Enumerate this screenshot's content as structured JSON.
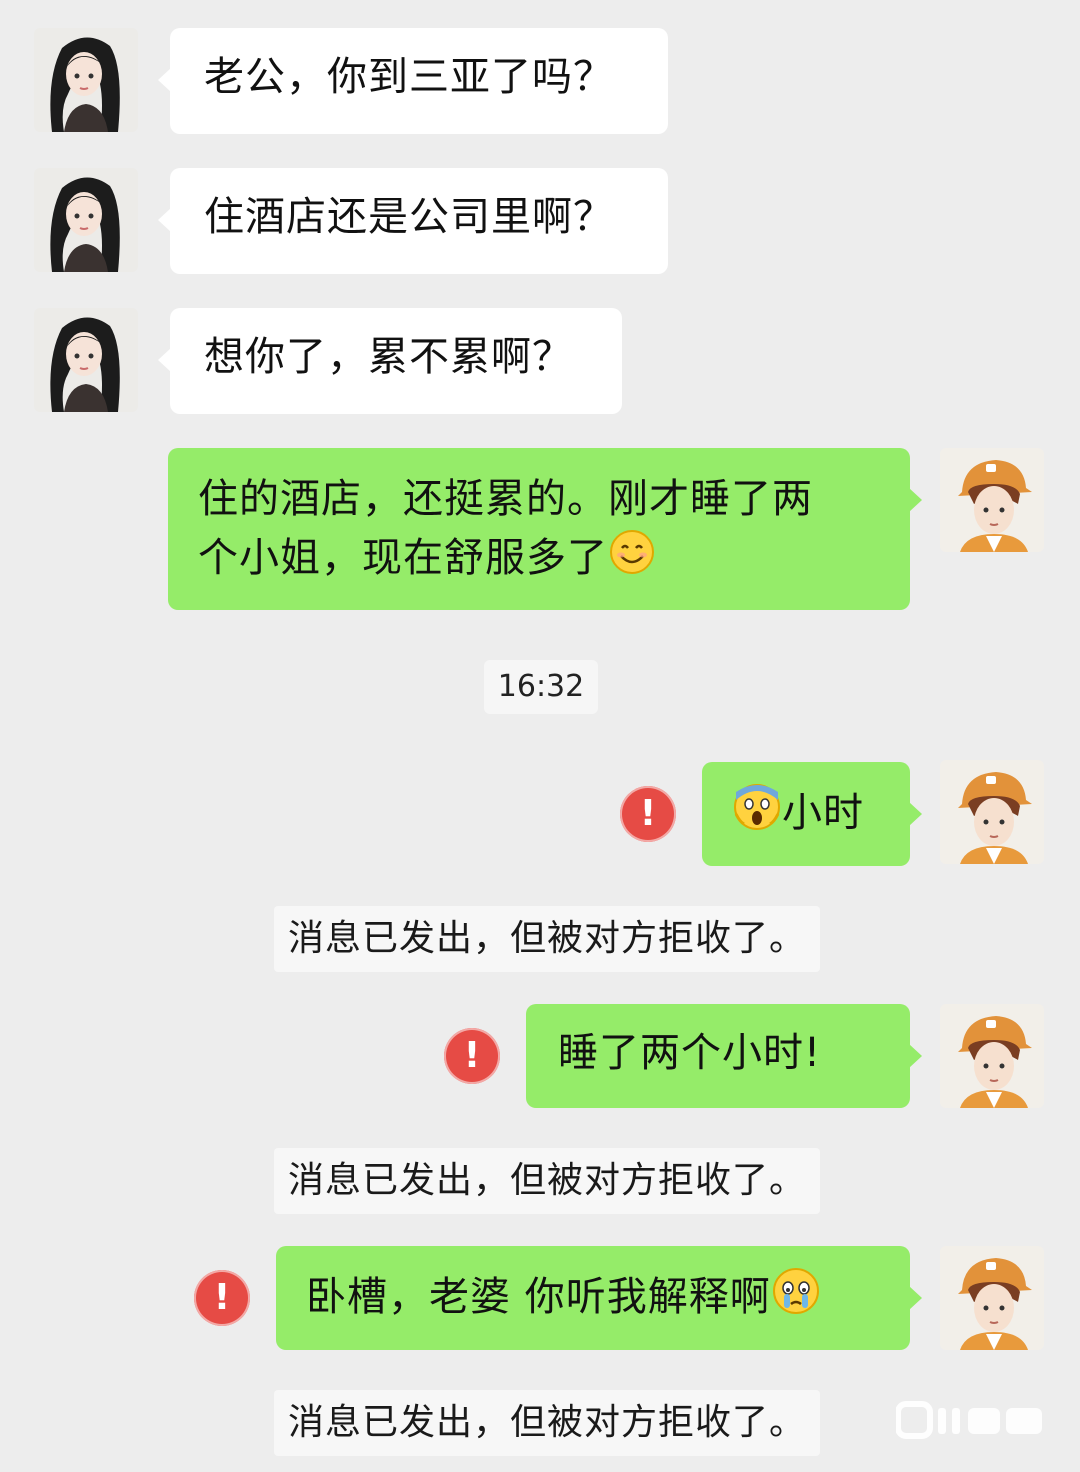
{
  "messages": [
    {
      "side": "in",
      "text": "老公，你到三亚了吗？"
    },
    {
      "side": "in",
      "text": "住酒店还是公司里啊？"
    },
    {
      "side": "in",
      "text": "想你了，累不累啊？"
    },
    {
      "side": "out",
      "text_line1": "住的酒店，还挺累的。刚才睡了两",
      "text_line2": "个小姐，现在舒服多了",
      "emoji": "smile-emoji"
    },
    {
      "side": "out",
      "emoji": "scream-emoji",
      "text": "小时",
      "failed": true
    },
    {
      "side": "out",
      "text": "睡了两个小时!",
      "failed": true
    },
    {
      "side": "out",
      "text": "卧槽，老婆 你听我解释啊",
      "emoji": "crying-emoji",
      "failed": true
    }
  ],
  "timestamp": "16:32",
  "rejected_notice": "消息已发出，但被对方拒收了。",
  "error_icon_glyph": "!",
  "colors": {
    "background": "#ededed",
    "incoming_bubble": "#ffffff",
    "outgoing_bubble": "#95ec69",
    "error": "#e64b45"
  }
}
